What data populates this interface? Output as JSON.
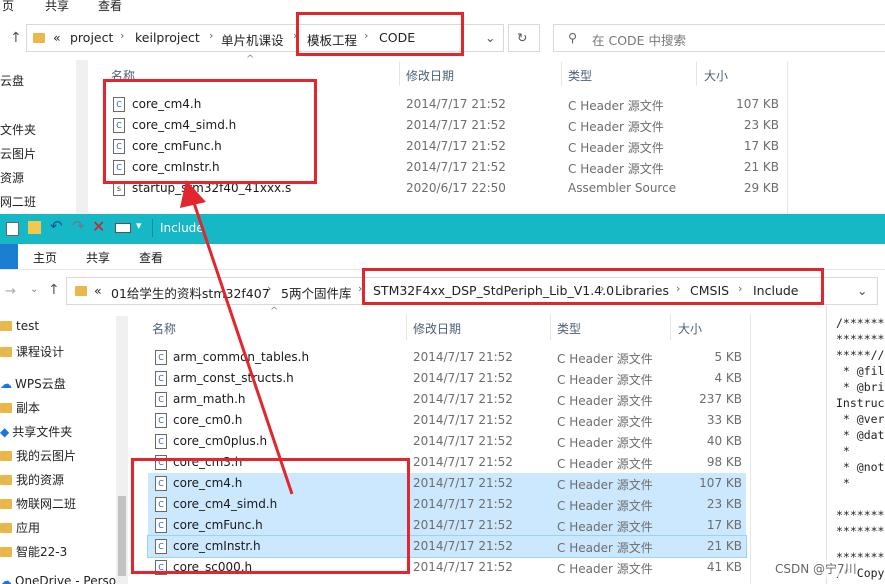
{
  "top_window": {
    "ribbon": [
      "页",
      "共享",
      "查看"
    ],
    "path": [
      "project",
      "keilproject",
      "单片机课设",
      "模板工程",
      "CODE"
    ],
    "path_prefix": "«",
    "search_placeholder": "在 CODE 中搜索",
    "sidebar": [
      "云盘",
      "文件夹",
      "云图片",
      "资源",
      "网二班"
    ],
    "columns": {
      "name": "名称",
      "date": "修改日期",
      "type": "类型",
      "size": "大小"
    },
    "files": [
      {
        "name": "core_cm4.h",
        "date": "2014/7/17 21:52",
        "type": "C Header 源文件",
        "size": "107 KB"
      },
      {
        "name": "core_cm4_simd.h",
        "date": "2014/7/17 21:52",
        "type": "C Header 源文件",
        "size": "23 KB"
      },
      {
        "name": "core_cmFunc.h",
        "date": "2014/7/17 21:52",
        "type": "C Header 源文件",
        "size": "17 KB"
      },
      {
        "name": "core_cmInstr.h",
        "date": "2014/7/17 21:52",
        "type": "C Header 源文件",
        "size": "21 KB"
      },
      {
        "name": "startup_stm32f40_41xxx.s",
        "date": "2020/6/17 22:50",
        "type": "Assembler Source",
        "size": "29 KB"
      }
    ]
  },
  "bottom_window": {
    "title": "Include",
    "ribbon": [
      "主页",
      "共享",
      "查看"
    ],
    "path_prefix": "«",
    "path": [
      "01给学生的资料stm32f407",
      "5两个固件库",
      "STM32F4xx_DSP_StdPeriph_Lib_V1.4.0",
      "Libraries",
      "CMSIS",
      "Include"
    ],
    "sidebar": [
      "test",
      "课程设计",
      "WPS云盘",
      "副本",
      "共享文件夹",
      "我的云图片",
      "我的资源",
      "物联网二班",
      "应用",
      "智能22-3",
      "OneDrive - Person"
    ],
    "columns": {
      "name": "名称",
      "date": "修改日期",
      "type": "类型",
      "size": "大小"
    },
    "files": [
      {
        "name": "arm_common_tables.h",
        "date": "2014/7/17 21:52",
        "type": "C Header 源文件",
        "size": "5 KB",
        "selected": false
      },
      {
        "name": "arm_const_structs.h",
        "date": "2014/7/17 21:52",
        "type": "C Header 源文件",
        "size": "4 KB",
        "selected": false
      },
      {
        "name": "arm_math.h",
        "date": "2014/7/17 21:52",
        "type": "C Header 源文件",
        "size": "237 KB",
        "selected": false
      },
      {
        "name": "core_cm0.h",
        "date": "2014/7/17 21:52",
        "type": "C Header 源文件",
        "size": "33 KB",
        "selected": false
      },
      {
        "name": "core_cm0plus.h",
        "date": "2014/7/17 21:52",
        "type": "C Header 源文件",
        "size": "40 KB",
        "selected": false
      },
      {
        "name": "core_cm3.h",
        "date": "2014/7/17 21:52",
        "type": "C Header 源文件",
        "size": "98 KB",
        "selected": false
      },
      {
        "name": "core_cm4.h",
        "date": "2014/7/17 21:52",
        "type": "C Header 源文件",
        "size": "107 KB",
        "selected": true
      },
      {
        "name": "core_cm4_simd.h",
        "date": "2014/7/17 21:52",
        "type": "C Header 源文件",
        "size": "23 KB",
        "selected": true
      },
      {
        "name": "core_cmFunc.h",
        "date": "2014/7/17 21:52",
        "type": "C Header 源文件",
        "size": "17 KB",
        "selected": true
      },
      {
        "name": "core_cmInstr.h",
        "date": "2014/7/17 21:52",
        "type": "C Header 源文件",
        "size": "21 KB",
        "selected": true
      },
      {
        "name": "core_sc000.h",
        "date": "2014/7/17 21:52",
        "type": "C Header 源文件",
        "size": "41 KB",
        "selected": false
      }
    ]
  },
  "code_panel": [
    "/*******",
    "********",
    "*****//",
    " * @fil",
    " * @bri",
    "Instruc",
    " * @ver",
    " * @dat",
    " *",
    " * @not",
    " *",
    "",
    "********",
    "********",
    "********",
    "/* Copy"
  ],
  "watermark": "CSDN @宁7川",
  "colors": {
    "teal_bar": "#16b8c6",
    "selection": "#cce8ff",
    "annotation_red": "#e3262e"
  }
}
